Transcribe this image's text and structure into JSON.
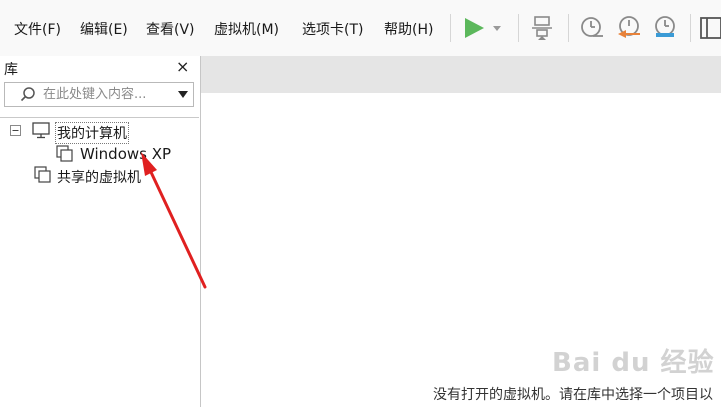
{
  "menu": {
    "items": [
      {
        "label": "文件(F)"
      },
      {
        "label": "编辑(E)"
      },
      {
        "label": "查看(V)"
      },
      {
        "label": "虚拟机(M)"
      },
      {
        "label": "选项卡(T)"
      },
      {
        "label": "帮助(H)"
      }
    ]
  },
  "toolbar": {
    "play_color": "#5cb85c",
    "snapshot_icons": [
      "snapshot-clock-icon",
      "snapshot-revert-icon",
      "snapshot-manager-icon"
    ]
  },
  "library": {
    "title": "库",
    "close_label": "×",
    "search_placeholder": "在此处键入内容...",
    "tree": {
      "my_computer": "我的计算机",
      "vm": "Windows XP",
      "shared": "共享的虚拟机"
    }
  },
  "main": {
    "status_text": "没有打开的虚拟机。请在库中选择一个项目以"
  },
  "watermark": {
    "text": "Bai du 经验"
  },
  "annotation": {
    "arrow_color": "#e02020"
  }
}
